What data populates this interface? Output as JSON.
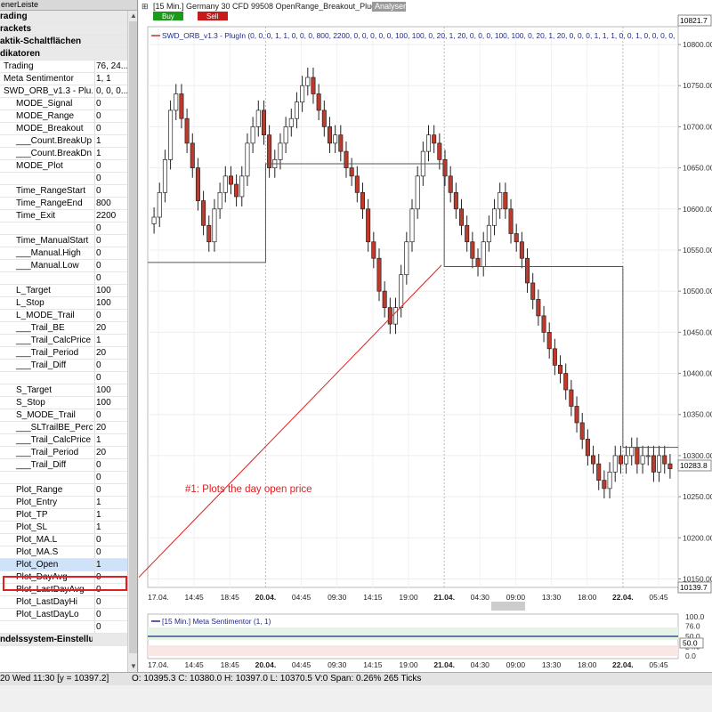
{
  "left_panel": {
    "title": "enerLeiste",
    "rows": [
      {
        "name": "rading",
        "value": "",
        "cat": true
      },
      {
        "name": "rackets",
        "value": "",
        "cat": true
      },
      {
        "name": "aktik-Schaltflächen",
        "value": "",
        "cat": true
      },
      {
        "name": "dikatoren",
        "value": "",
        "cat": true
      },
      {
        "name": "Trading",
        "value": "76, 24..."
      },
      {
        "name": "Meta Sentimentor",
        "value": "1, 1"
      },
      {
        "name": "SWD_ORB_v1.3 - Plu...",
        "value": "0, 0, 0..."
      },
      {
        "name": "MODE_Signal",
        "value": "0"
      },
      {
        "name": "MODE_Range",
        "value": "0"
      },
      {
        "name": "MODE_Breakout",
        "value": "0"
      },
      {
        "name": "___Count.BreakUp",
        "value": "1"
      },
      {
        "name": "___Count.BreakDn",
        "value": "1"
      },
      {
        "name": "MODE_Plot",
        "value": "0"
      },
      {
        "name": "",
        "value": "0"
      },
      {
        "name": "Time_RangeStart",
        "value": "0"
      },
      {
        "name": "Time_RangeEnd",
        "value": "800"
      },
      {
        "name": "Time_Exit",
        "value": "2200"
      },
      {
        "name": "",
        "value": "0"
      },
      {
        "name": "Time_ManualStart",
        "value": "0"
      },
      {
        "name": "___Manual.High",
        "value": "0"
      },
      {
        "name": "___Manual.Low",
        "value": "0"
      },
      {
        "name": "",
        "value": "0"
      },
      {
        "name": "L_Target",
        "value": "100"
      },
      {
        "name": "L_Stop",
        "value": "100"
      },
      {
        "name": "L_MODE_Trail",
        "value": "0"
      },
      {
        "name": "___Trail_BE",
        "value": "20"
      },
      {
        "name": "___Trail_CalcPrice",
        "value": "1"
      },
      {
        "name": "___Trail_Period",
        "value": "20"
      },
      {
        "name": "___Trail_Diff",
        "value": "0"
      },
      {
        "name": "",
        "value": "0"
      },
      {
        "name": "S_Target",
        "value": "100"
      },
      {
        "name": "S_Stop",
        "value": "100"
      },
      {
        "name": "S_MODE_Trail",
        "value": "0"
      },
      {
        "name": "___SLTrailBE_Perc",
        "value": "20"
      },
      {
        "name": "___Trail_CalcPrice",
        "value": "1"
      },
      {
        "name": "___Trail_Period",
        "value": "20"
      },
      {
        "name": "___Trail_Diff",
        "value": "0"
      },
      {
        "name": "",
        "value": "0"
      },
      {
        "name": "Plot_Range",
        "value": "0"
      },
      {
        "name": "Plot_Entry",
        "value": "1"
      },
      {
        "name": "Plot_TP",
        "value": "1"
      },
      {
        "name": "Plot_SL",
        "value": "1"
      },
      {
        "name": "Plot_MA.L",
        "value": "0"
      },
      {
        "name": "Plot_MA.S",
        "value": "0"
      },
      {
        "name": "Plot_Open",
        "value": "1",
        "sel": true
      },
      {
        "name": "Plot_DayAvg",
        "value": "0"
      },
      {
        "name": "Plot_LastDayAvg",
        "value": "0"
      },
      {
        "name": "Plot_LastDayHi",
        "value": "0"
      },
      {
        "name": "Plot_LastDayLo",
        "value": "0"
      },
      {
        "name": "",
        "value": "0"
      },
      {
        "name": "ndelssystem-Einstellungen",
        "value": "",
        "cat": true
      }
    ]
  },
  "chart": {
    "header": "[15 Min.] Germany 30 CFD   99508 OpenRange_Breakout_PlugIn",
    "analysen_label": "Analysen",
    "buy_label": "Buy",
    "sell_label": "Sell",
    "indicator_label": "SWD_ORB_v1.3 - PlugIn  (0, 0, 0, 1, 1, 0, 0, 0, 800, 2200, 0, 0, 0, 0, 0, 100, 100, 0, 20, 1, 20, 0, 0, 0, 100, 100, 0, 20, 1, 20, 0, 0, 0, 1, 1, 1, 0, 0, 1, 0, 0, 0, 0,",
    "price_top_box": "10821.7",
    "price_last_box": "10283.8",
    "price_bottom_box": "10139.7",
    "annotation": "#1: Plots the day open price",
    "sub_label": "[15 Min.] Meta Sentimentor  (1, 1)",
    "sub_value_box": "50.0",
    "colors": {
      "up": "#000000",
      "down": "#c0392b",
      "open_line": "#555555",
      "annotation": "#e02020",
      "senti": "#1f2a8a"
    }
  },
  "chart_data": [
    {
      "type": "line",
      "title": "",
      "series_desc": "candlestick price (close path)",
      "ylim": [
        10139.7,
        10821.7
      ],
      "yticks": [
        10800,
        10750,
        10700,
        10650,
        10600,
        10550,
        10500,
        10450,
        10400,
        10350,
        10300,
        10250,
        10200,
        10150
      ],
      "x_tick_labels": [
        "17.04.",
        "14:45",
        "18:45",
        "20.04.",
        "04:45",
        "09:30",
        "14:15",
        "19:00",
        "21.04.",
        "04:30",
        "09:00",
        "13:30",
        "18:00",
        "22.04.",
        "05:45"
      ],
      "close": [
        10590,
        10620,
        10660,
        10720,
        10740,
        10710,
        10680,
        10650,
        10610,
        10580,
        10560,
        10600,
        10620,
        10640,
        10630,
        10615,
        10640,
        10680,
        10700,
        10720,
        10690,
        10650,
        10660,
        10680,
        10700,
        10710,
        10730,
        10750,
        10760,
        10740,
        10720,
        10700,
        10680,
        10690,
        10670,
        10650,
        10640,
        10620,
        10600,
        10560,
        10540,
        10500,
        10480,
        10460,
        10480,
        10520,
        10560,
        10600,
        10640,
        10670,
        10690,
        10680,
        10660,
        10640,
        10620,
        10600,
        10580,
        10560,
        10540,
        10530,
        10560,
        10580,
        10600,
        10620,
        10600,
        10570,
        10560,
        10540,
        10510,
        10490,
        10470,
        10450,
        10430,
        10410,
        10400,
        10380,
        10360,
        10340,
        10320,
        10300,
        10290,
        10270,
        10260,
        10280,
        10300,
        10290,
        10300,
        10310,
        10290,
        10300,
        10300,
        10280,
        10300,
        10290,
        10284
      ],
      "day_open_steps": [
        {
          "from": "17.04.",
          "value": 10535
        },
        {
          "from": "20.04.",
          "value": 10655
        },
        {
          "from": "21.04.",
          "value": 10530
        },
        {
          "from": "22.04.",
          "value": 10310
        }
      ]
    },
    {
      "type": "line",
      "title": "",
      "ylim": [
        0,
        100
      ],
      "yticks": [
        100.0,
        76.0,
        50.0,
        24.0,
        0.0
      ],
      "values_const": 50.0
    }
  ],
  "status": {
    "left": "20 Wed  11:30  [y = 10397.2]",
    "right": "O: 10395.3 C: 10380.0 H: 10397.0 L: 10370.5 V:0 Span: 0.26% 265 Ticks"
  }
}
